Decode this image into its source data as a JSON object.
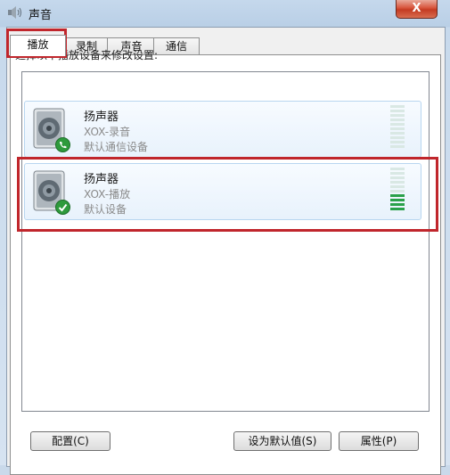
{
  "window": {
    "title": "声音",
    "close_label": "X",
    "title_icon": "speaker-icon"
  },
  "tabs": [
    {
      "label": "播放",
      "active": true
    },
    {
      "label": "录制",
      "active": false
    },
    {
      "label": "声音",
      "active": false
    },
    {
      "label": "通信",
      "active": false
    }
  ],
  "instructions": "选择以下播放设备来修改设置:",
  "devices": [
    {
      "name": "扬声器",
      "subtitle": "XOX-录音",
      "status": "默认通信设备",
      "badge": "phone-icon",
      "level_fraction": 0.0
    },
    {
      "name": "扬声器",
      "subtitle": "XOX-播放",
      "status": "默认设备",
      "badge": "checkmark-icon",
      "level_fraction": 0.4
    }
  ],
  "buttons": {
    "configure": "配置(C)",
    "set_default": "设为默认值(S)",
    "properties": "属性(P)"
  },
  "colors": {
    "highlight_box": "#c0262c",
    "meter_on": "#2aa14a",
    "badge": "#2e9a3c"
  }
}
